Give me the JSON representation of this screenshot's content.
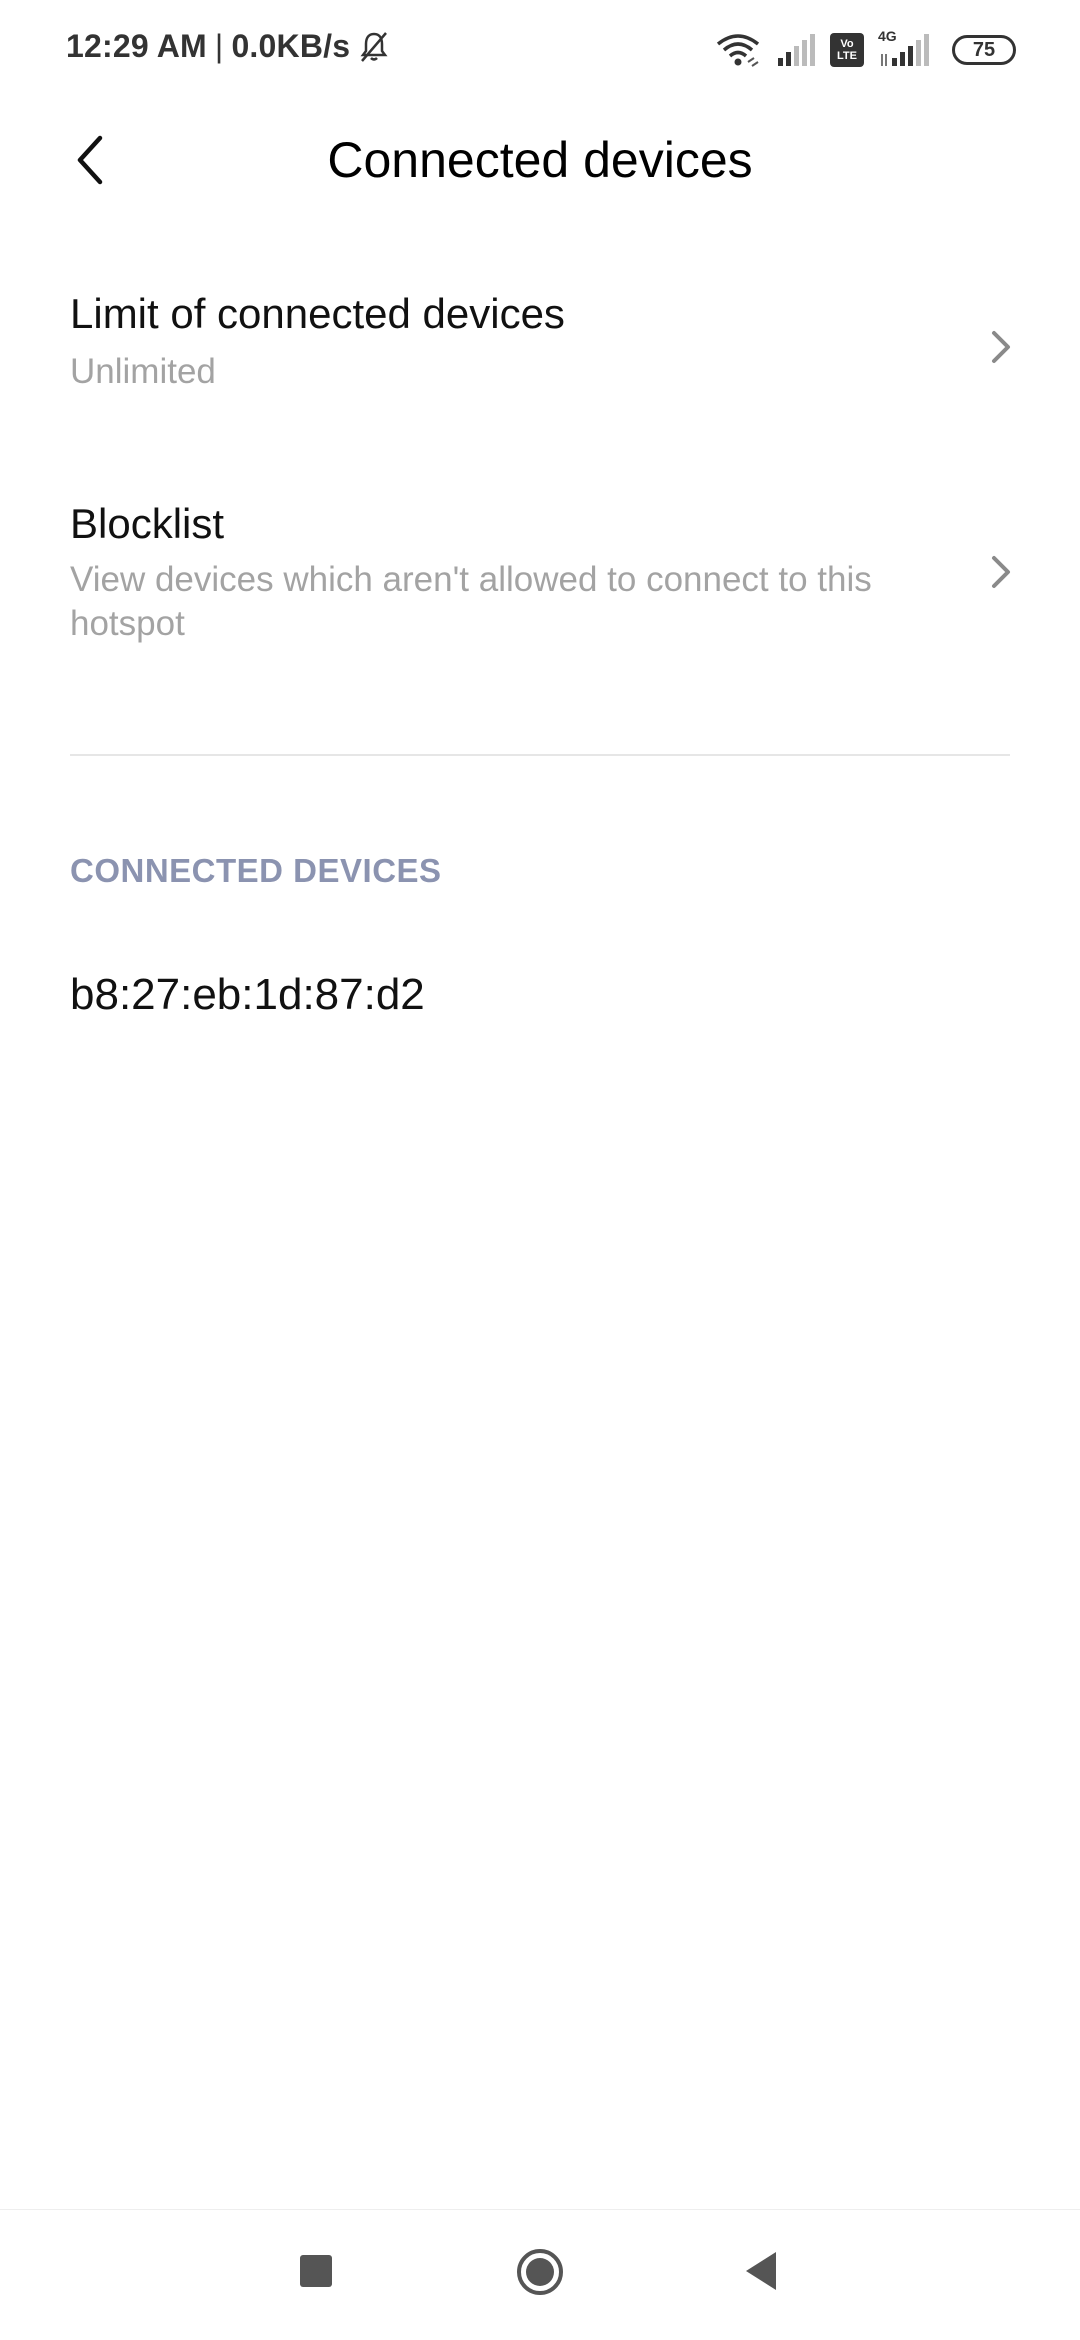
{
  "status_bar": {
    "time": "12:29 AM",
    "separator": "|",
    "network_speed": "0.0KB/s",
    "volte_top": "Vo",
    "volte_bottom": "LTE",
    "network_type": "4G",
    "battery_level": "75",
    "icons": [
      "mute-bell-icon",
      "wifi-icon",
      "signal-icon",
      "volte-icon",
      "signal-4g-icon",
      "battery-icon"
    ]
  },
  "header": {
    "title": "Connected devices",
    "back_icon": "back-arrow-icon"
  },
  "settings": [
    {
      "title": "Limit of connected devices",
      "subtitle": "Unlimited"
    },
    {
      "title": "Blocklist",
      "subtitle": "View devices which aren't allowed to connect to this hotspot"
    }
  ],
  "connected_section": {
    "header": "CONNECTED DEVICES",
    "devices": [
      "b8:27:eb:1d:87:d2"
    ]
  },
  "nav_bar": {
    "icons": [
      "recent-apps-icon",
      "home-icon",
      "back-icon"
    ]
  },
  "colors": {
    "section_header": "#8b93b0",
    "subtitle": "#a3a3a3",
    "divider": "#e6e6e6"
  }
}
